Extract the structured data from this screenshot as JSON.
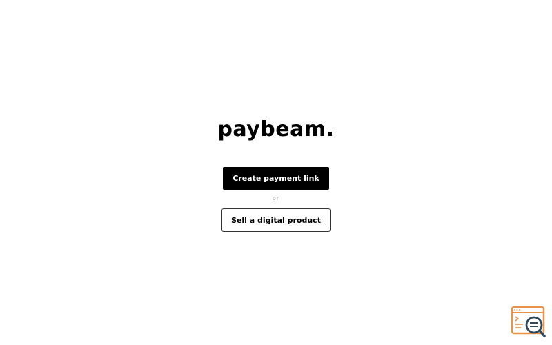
{
  "brand": {
    "logo_text": "paybeam."
  },
  "actions": {
    "primary_label": "Create payment link",
    "separator": "or",
    "secondary_label": "Sell a digital product"
  },
  "widget": {
    "icon": "browser-search-icon",
    "accent_color": "#E8924A",
    "secondary_color": "#2E4A5C"
  }
}
